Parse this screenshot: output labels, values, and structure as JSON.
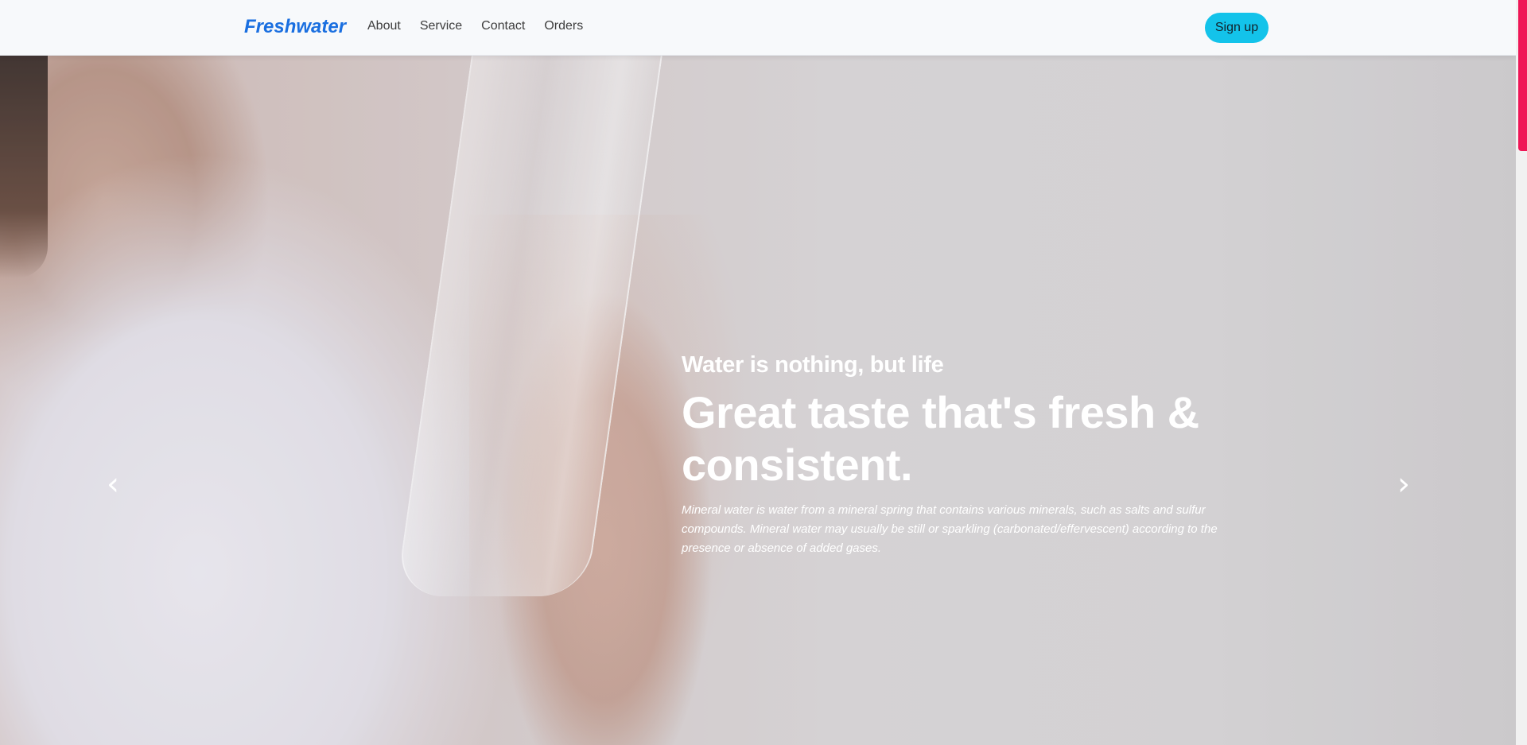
{
  "navbar": {
    "brand": "Freshwater",
    "links": [
      "About",
      "Service",
      "Contact",
      "Orders"
    ],
    "signup_label": "Sign up"
  },
  "hero": {
    "eyebrow": "Water is nothing, but life",
    "headline": "Great taste that's fresh & consistent.",
    "description": "Mineral water is water from a mineral spring that contains various minerals, such as salts and sulfur compounds. Mineral water may usually be still or sparkling (carbonated/effervescent) according to the presence or absence of added gases.",
    "prev_icon": "‹",
    "next_icon": "›"
  },
  "colors": {
    "brand": "#1a6fe0",
    "signup": "#13c3ea",
    "scroll_thumb": "#ef1656"
  }
}
